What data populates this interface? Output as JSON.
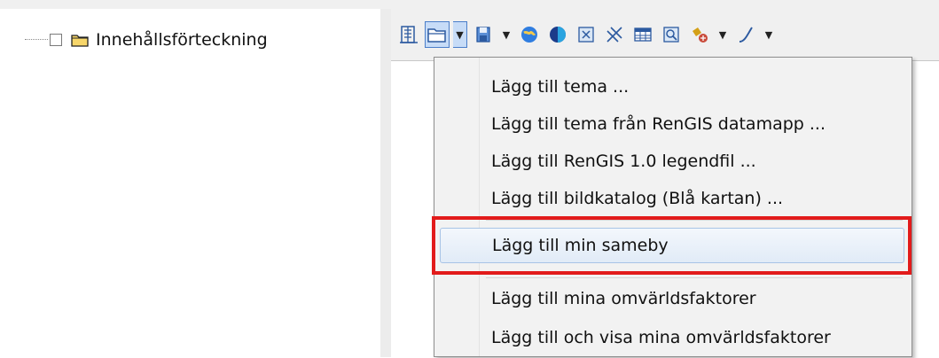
{
  "toc": {
    "root_label": "Innehållsförteckning"
  },
  "toolbar": {
    "icons": [
      "select-icon",
      "add-data-icon",
      "save-icon",
      "globe-icon",
      "shade-icon",
      "identify-icon",
      "tools-icon",
      "table-icon",
      "zoom-icon",
      "layer-tool-icon",
      "line-tool-icon"
    ]
  },
  "menu": {
    "items": [
      "Lägg till tema ...",
      "Lägg till tema från RenGIS datamapp ...",
      "Lägg till RenGIS 1.0 legendfil ...",
      "Lägg till bildkatalog (Blå kartan) ...",
      "Lägg till min sameby",
      "Lägg till mina omvärldsfaktorer",
      "Lägg till och visa mina omvärldsfaktorer"
    ],
    "highlighted_index": 4
  },
  "colors": {
    "highlight_border": "#e21b1b",
    "hover_fill": "#e1ebf7",
    "active_button": "#c7dcf7"
  }
}
